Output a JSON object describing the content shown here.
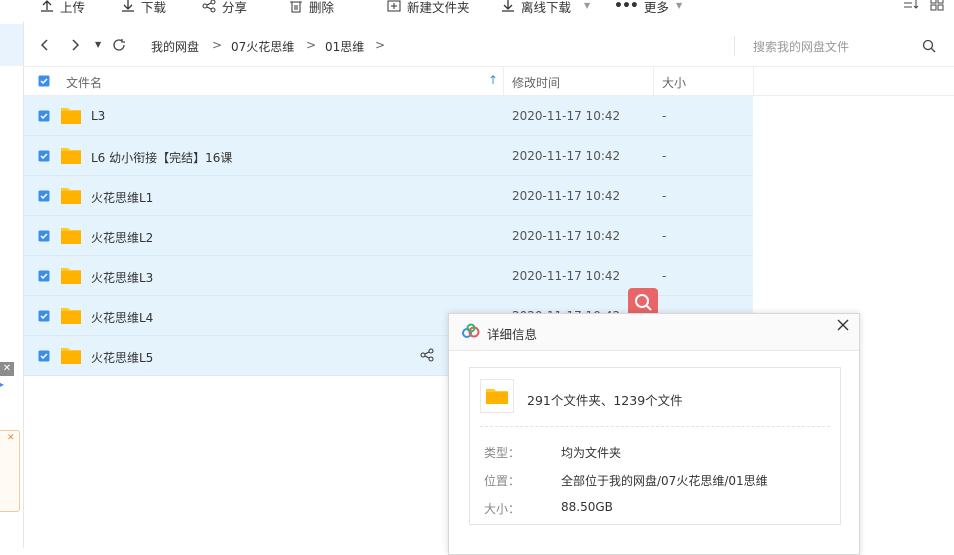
{
  "toolbar": {
    "upload": "上传",
    "download": "下载",
    "share": "分享",
    "delete": "删除",
    "new_folder": "新建文件夹",
    "offline_download": "离线下载",
    "more": "更多"
  },
  "breadcrumb": {
    "items": [
      "我的网盘",
      "07火花思维",
      "01思维"
    ],
    "separator": ">"
  },
  "search": {
    "placeholder": "搜索我的网盘文件"
  },
  "table": {
    "columns": {
      "name": "文件名",
      "modified": "修改时间",
      "size": "大小"
    },
    "rows": [
      {
        "name": "L3",
        "modified": "2020-11-17 10:42",
        "size": "-"
      },
      {
        "name": "L6 幼小衔接【完结】16课",
        "modified": "2020-11-17 10:42",
        "size": "-"
      },
      {
        "name": "火花思维L1",
        "modified": "2020-11-17 10:42",
        "size": "-"
      },
      {
        "name": "火花思维L2",
        "modified": "2020-11-17 10:42",
        "size": "-"
      },
      {
        "name": "火花思维L3",
        "modified": "2020-11-17 10:42",
        "size": "-"
      },
      {
        "name": "火花思维L4",
        "modified": "2020-11-17 10:42",
        "size": ""
      },
      {
        "name": "火花思维L5",
        "modified": "",
        "size": ""
      }
    ]
  },
  "dialog": {
    "title": "详细信息",
    "summary": "291个文件夹、1239个文件",
    "type_label": "类型：",
    "type_value": "均为文件夹",
    "location_label": "位置：",
    "location_value": "全部位于我的网盘/07火花思维/01思维",
    "size_label": "大小：",
    "size_value": "88.50GB"
  },
  "colors": {
    "row_selected": "#e5f3fd",
    "checkbox": "#3d8ee8",
    "folder": "#ffc82c",
    "search_float": "#e95b5b"
  }
}
